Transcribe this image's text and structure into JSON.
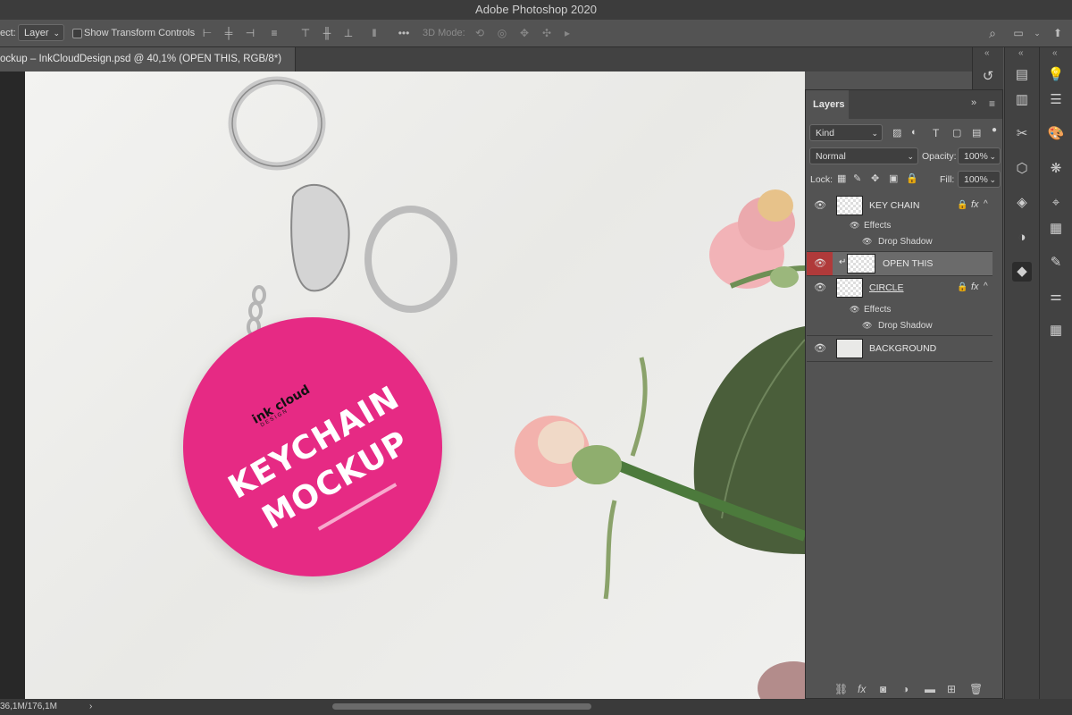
{
  "app": {
    "title": "Adobe Photoshop 2020"
  },
  "options": {
    "select_label": "ect:",
    "layer_select": "Layer",
    "transform_label": "Show Transform Controls",
    "three_d_label": "3D Mode:"
  },
  "document": {
    "tab_title": "ockup – InkCloudDesign.psd @ 40,1% (OPEN THIS, RGB/8*)"
  },
  "status": {
    "doc_size": "36,1M/176,1M",
    "arrow": "›"
  },
  "canvas": {
    "brand_name": "ink cloud",
    "brand_sub": "DESIGN",
    "line1": "KEYCHAIN",
    "line2": "MOCKUP",
    "tag_color": "#e62a84"
  },
  "layers_panel": {
    "tab": "Layers",
    "filter_kind": "Kind",
    "blend_mode": "Normal",
    "opacity_label": "Opacity:",
    "opacity_value": "100%",
    "lock_label": "Lock:",
    "fill_label": "Fill:",
    "fill_value": "100%",
    "layers": [
      {
        "name": "KEY CHAIN",
        "effects": "Effects",
        "effect": "Drop Shadow"
      },
      {
        "name": "OPEN THIS"
      },
      {
        "name": "CIRCLE",
        "effects": "Effects",
        "effect": "Drop Shadow"
      },
      {
        "name": "BACKGROUND"
      }
    ],
    "fx": "fx"
  }
}
